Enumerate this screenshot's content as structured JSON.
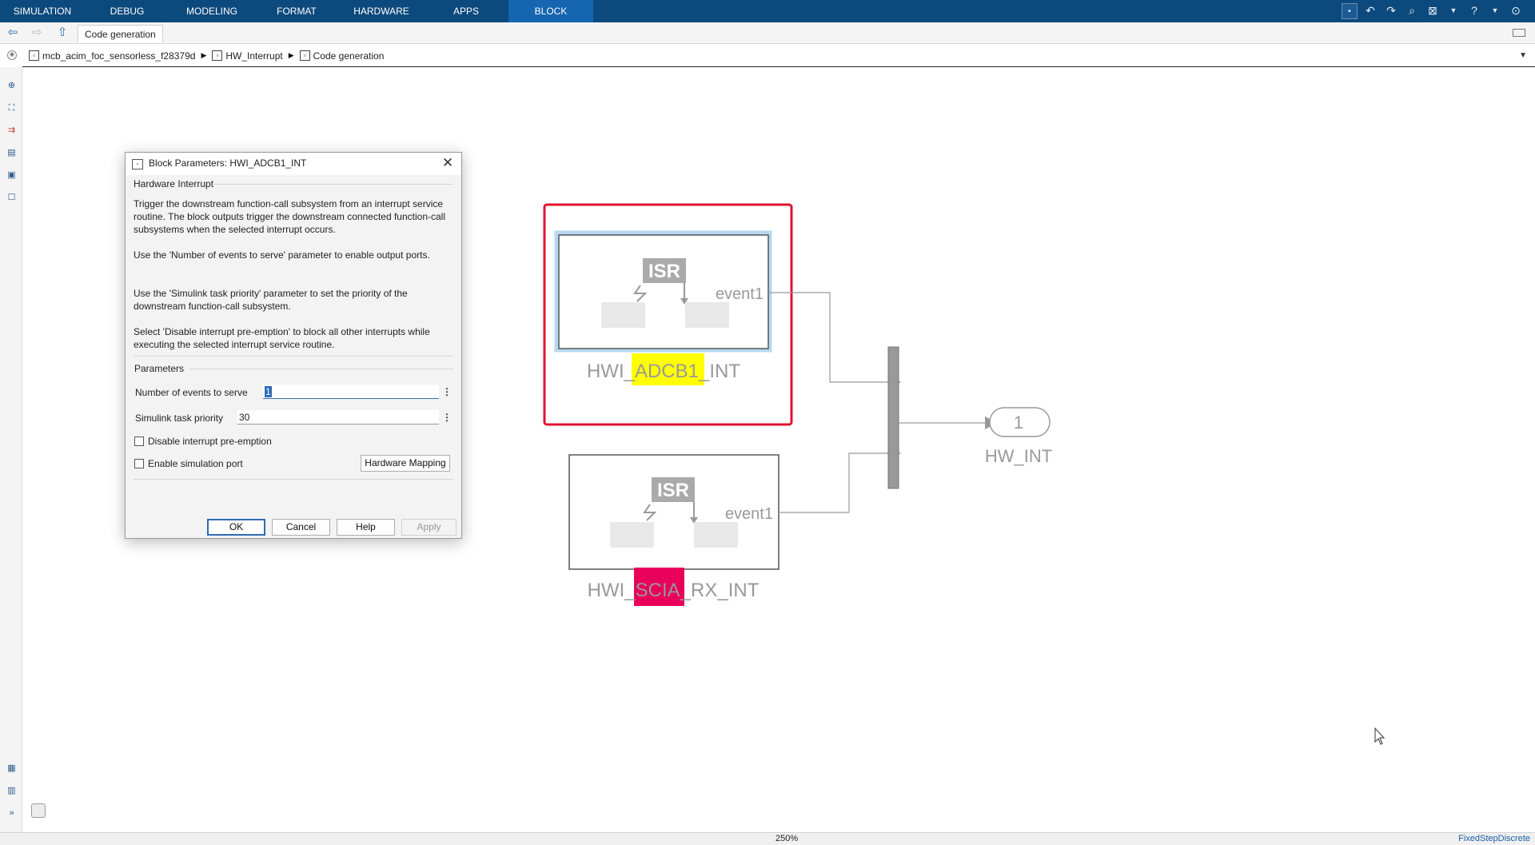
{
  "ribbon": {
    "tabs": [
      {
        "label": "SIMULATION",
        "active": false
      },
      {
        "label": "DEBUG",
        "active": false
      },
      {
        "label": "MODELING",
        "active": false
      },
      {
        "label": "FORMAT",
        "active": false
      },
      {
        "label": "HARDWARE",
        "active": false
      },
      {
        "label": "APPS",
        "active": false
      },
      {
        "label": "BLOCK",
        "active": true
      }
    ],
    "active_color": "#1565b0",
    "bar_color": "#0c4a7d"
  },
  "navbar": {
    "tab_label": "Code generation"
  },
  "breadcrumb": {
    "items": [
      "mcb_acim_foc_sensorless_f28379d",
      "HW_Interrupt",
      "Code generation"
    ]
  },
  "diagram": {
    "block1": {
      "isr_label": "ISR",
      "port_label": "event1",
      "name_prefix": "HWI_",
      "name_highlight": "ADCB1",
      "name_suffix": "_INT",
      "highlight_color": "#ffff00"
    },
    "block2": {
      "isr_label": "ISR",
      "port_label": "event1",
      "name_prefix": "HWI_",
      "name_highlight": "SCIA",
      "name_suffix": "_RX_INT",
      "highlight_color": "#e8005a"
    },
    "outport": {
      "number": "1",
      "name": "HW_INT"
    },
    "selection_color": "#e0102f"
  },
  "status": {
    "zoom": "250%",
    "solver": "FixedStepDiscrete"
  },
  "dialog": {
    "title": "Block Parameters: HWI_ADCB1_INT",
    "heading": "Hardware Interrupt",
    "desc1": "Trigger the downstream function-call subsystem from an interrupt service routine. The block outputs trigger the downstream connected function-call subsystems when the selected interrupt occurs.",
    "desc2": "Use the 'Number of events to serve' parameter to enable output ports.",
    "desc3": "Use the 'Simulink task priority' parameter to set the priority of the downstream function-call subsystem.",
    "desc4": "Select 'Disable interrupt pre-emption' to block all other interrupts while executing the selected interrupt service routine.",
    "params_title": "Parameters",
    "events_label": "Number of events to serve",
    "events_value": "1",
    "priority_label": "Simulink task priority",
    "priority_value": "30",
    "disable_preemption_label": "Disable interrupt pre-emption",
    "disable_preemption_checked": false,
    "enable_sim_port_label": "Enable simulation port",
    "enable_sim_port_checked": false,
    "hw_mapping_label": "Hardware Mapping",
    "ok_label": "OK",
    "cancel_label": "Cancel",
    "help_label": "Help",
    "apply_label": "Apply"
  }
}
